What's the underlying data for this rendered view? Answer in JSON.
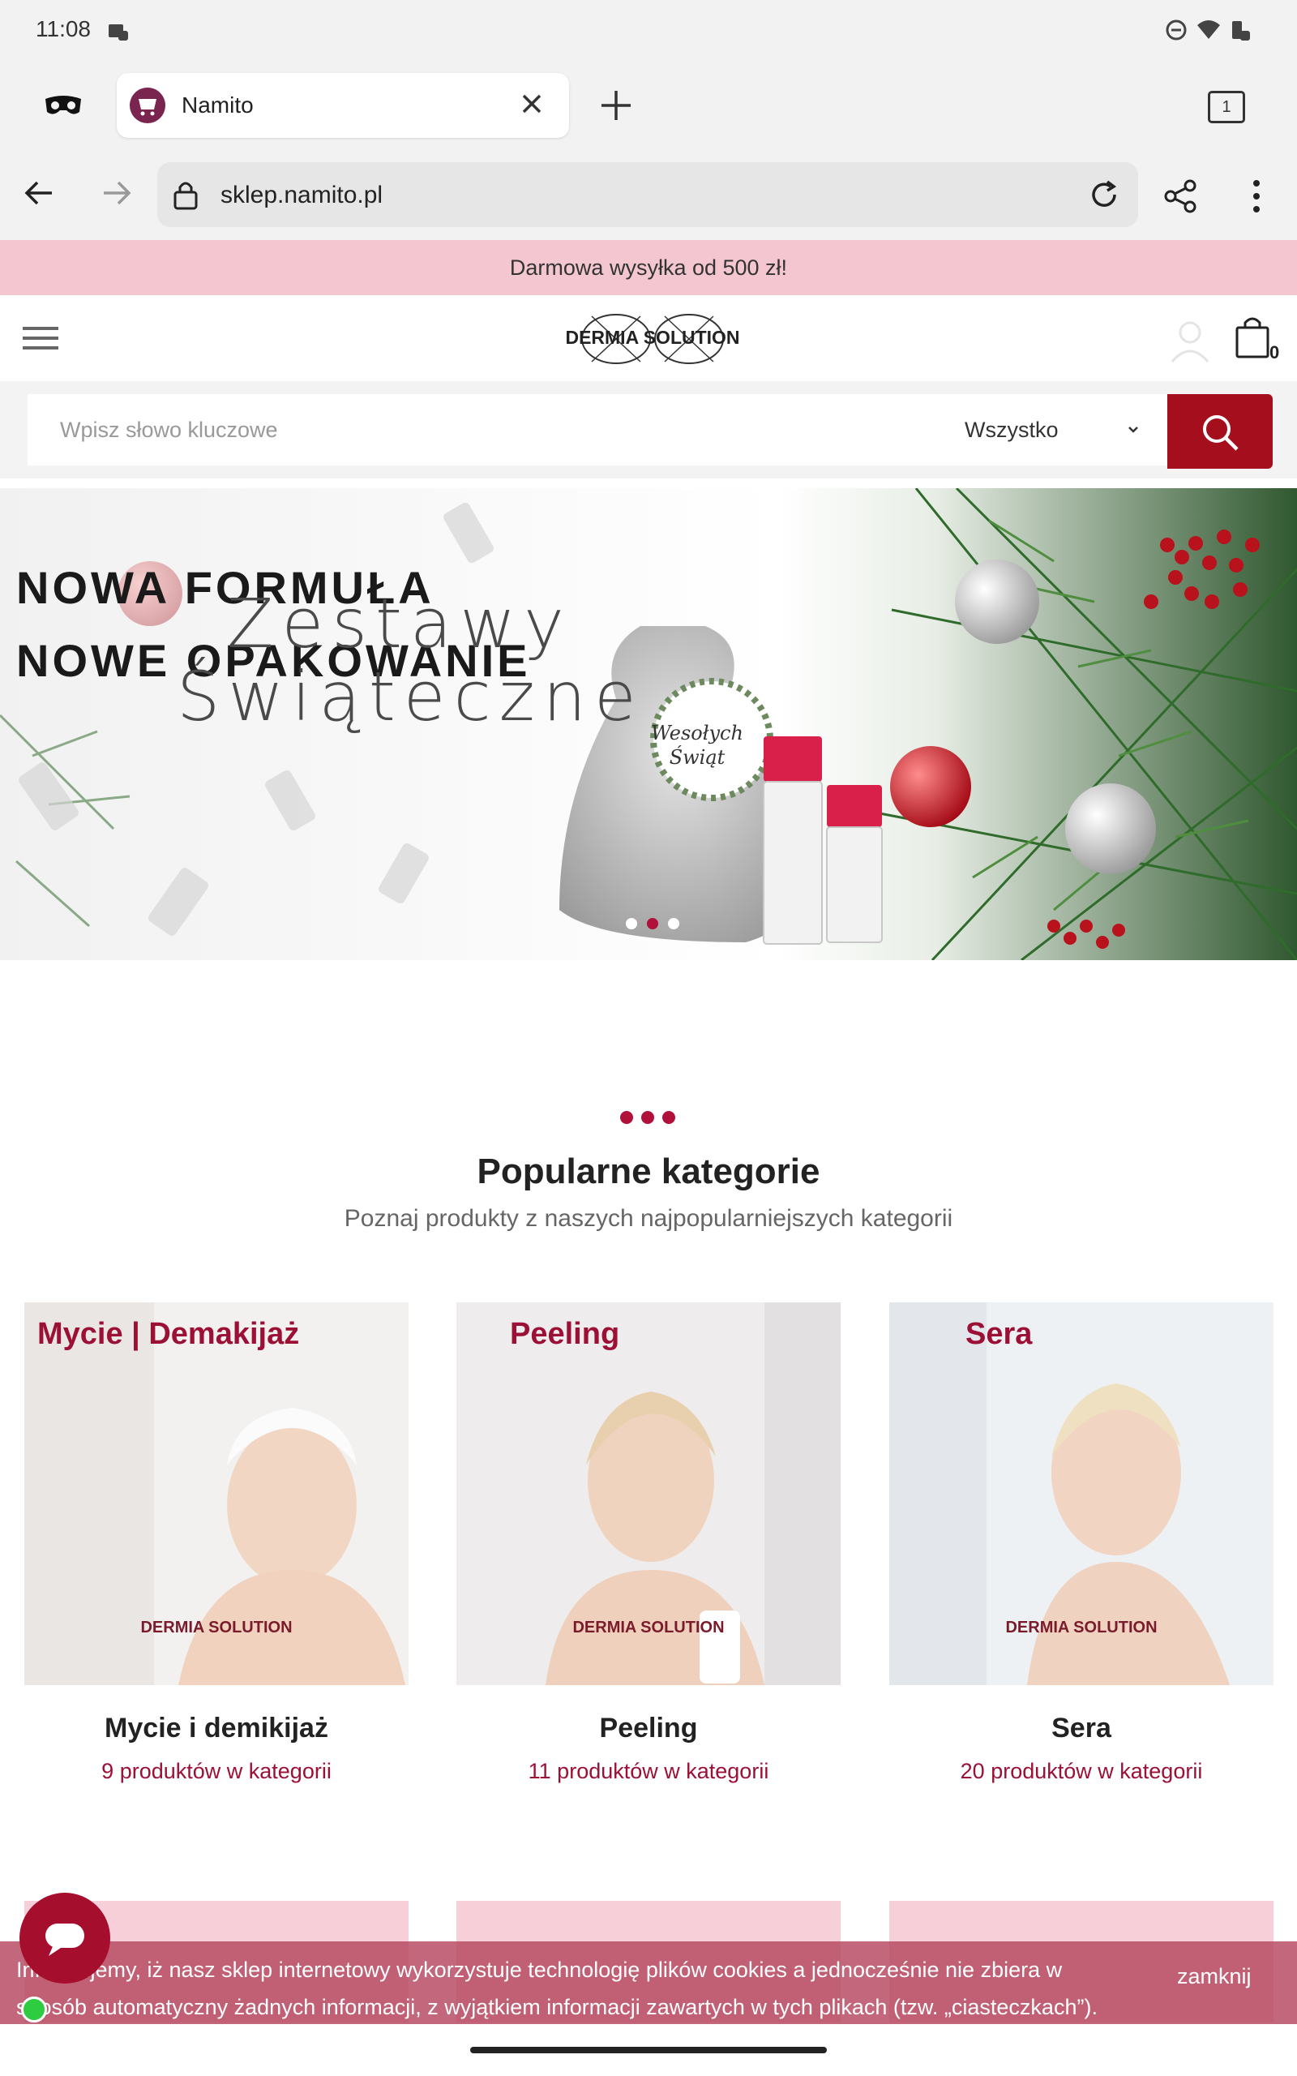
{
  "status_bar": {
    "time": "11:08"
  },
  "browser": {
    "tab_title": "Namito",
    "tab_count": "1",
    "url": "sklep.namito.pl"
  },
  "promo": {
    "text": "Darmowa wysyłka od 500 zł!"
  },
  "header": {
    "logo_text": "DERMIA SOLUTION",
    "cart_count": "0"
  },
  "search": {
    "placeholder": "Wpisz słowo kluczowe",
    "category": "Wszystko"
  },
  "hero": {
    "line1": "NOWA FORMUŁA",
    "line2": "NOWE OPAKOWANIE",
    "script1": "Zestawy",
    "script2": "Świąteczne",
    "bag_label_1": "Wesołych",
    "bag_label_2": "Świąt"
  },
  "popular": {
    "title": "Popularne kategorie",
    "subtitle": "Poznaj produkty z naszych najpopularniejszych kategorii",
    "categories": [
      {
        "tag": "Mycie | Demakijaż",
        "name": "Mycie i demikijaż",
        "count": "9 produktów w kategorii",
        "brand": "DERMIA SOLUTION"
      },
      {
        "tag": "Peeling",
        "name": "Peeling",
        "count": "11 produktów w kategorii",
        "brand": "DERMIA SOLUTION"
      },
      {
        "tag": "Sera",
        "name": "Sera",
        "count": "20 produktów w kategorii",
        "brand": "DERMIA SOLUTION"
      }
    ]
  },
  "cookie": {
    "text": "Informujemy, iż nasz sklep internetowy wykorzystuje technologię plików cookies a jednocześnie nie zbiera w sposób automatyczny żadnych informacji, z wyjątkiem informacji zawartych w tych plikach (tzw. „ciasteczkach”).",
    "close": "zamknij"
  },
  "colors": {
    "accent": "#a50e1d",
    "brand": "#9c1036",
    "promo_bg": "#f4c6cf"
  }
}
